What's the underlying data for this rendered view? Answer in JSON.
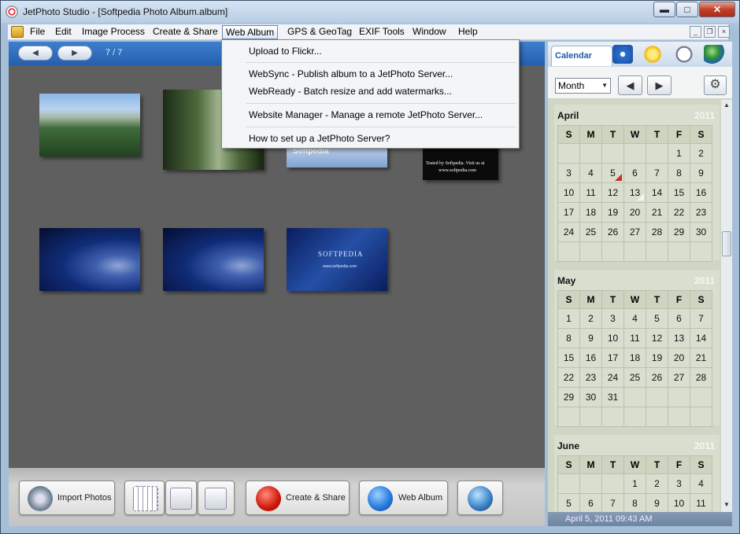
{
  "window": {
    "title": "JetPhoto Studio - [Softpedia Photo Album.album]",
    "controls": {
      "minimize": "▬",
      "maximize": "□",
      "close": "✕"
    }
  },
  "menubar": {
    "items": [
      "File",
      "Edit",
      "Image Process",
      "Create & Share",
      "Web Album",
      "GPS & GeoTag",
      "EXIF Tools",
      "Window",
      "Help"
    ],
    "mdi": {
      "minimize": "_",
      "restore": "❐",
      "close": "×"
    }
  },
  "web_album_menu": {
    "items": [
      "Upload to Flickr...",
      "WebSync - Publish album to a JetPhoto Server...",
      "WebReady - Batch resize and add watermarks...",
      "Website Manager - Manage a remote JetPhoto Server...",
      "How to set up a JetPhoto Server?"
    ]
  },
  "browser": {
    "prev": "◀",
    "next": "▶",
    "counter": "7 / 7",
    "thumbnails": [
      {
        "desc": "mountain forest"
      },
      {
        "desc": "misty forest"
      },
      {
        "desc": "softpedia banner"
      },
      {
        "desc": "tested by softpedia"
      },
      {
        "desc": "blue S logo"
      },
      {
        "desc": "blue S logo 2"
      },
      {
        "desc": "softpedia wallpaper"
      }
    ],
    "thumb_text": {
      "t3": "Softpedia",
      "t4_line1": "Tested by Softpedia. Visit us at",
      "t4_line2": "www.softpedia.com",
      "t7_title": "SOFTPEDIA",
      "t7_url": "www.softpedia.com"
    }
  },
  "bottom_toolbar": {
    "import_label": "Import Photos",
    "create_share_label": "Create & Share",
    "web_album_label": "Web Album"
  },
  "calendar": {
    "tab_label": "Calendar",
    "view_select": "Month",
    "prev": "◀",
    "next": "▶",
    "gear": "⚙",
    "weekdays": [
      "S",
      "M",
      "T",
      "W",
      "T",
      "F",
      "S"
    ],
    "months": [
      {
        "name": "April",
        "year": "2011",
        "weeks": [
          [
            "",
            "",
            "",
            "",
            "",
            "1",
            "2"
          ],
          [
            "3",
            "4",
            "5",
            "6",
            "7",
            "8",
            "9"
          ],
          [
            "10",
            "11",
            "12",
            "13",
            "14",
            "15",
            "16"
          ],
          [
            "17",
            "18",
            "19",
            "20",
            "21",
            "22",
            "23"
          ],
          [
            "24",
            "25",
            "26",
            "27",
            "28",
            "29",
            "30"
          ],
          [
            "",
            "",
            "",
            "",
            "",
            "",
            ""
          ]
        ]
      },
      {
        "name": "May",
        "year": "2011",
        "weeks": [
          [
            "1",
            "2",
            "3",
            "4",
            "5",
            "6",
            "7"
          ],
          [
            "8",
            "9",
            "10",
            "11",
            "12",
            "13",
            "14"
          ],
          [
            "15",
            "16",
            "17",
            "18",
            "19",
            "20",
            "21"
          ],
          [
            "22",
            "23",
            "24",
            "25",
            "26",
            "27",
            "28"
          ],
          [
            "29",
            "30",
            "31",
            "",
            "",
            "",
            ""
          ],
          [
            "",
            "",
            "",
            "",
            "",
            "",
            ""
          ]
        ]
      },
      {
        "name": "June",
        "year": "2011",
        "weeks": [
          [
            "",
            "",
            "",
            "1",
            "2",
            "3",
            "4"
          ],
          [
            "5",
            "6",
            "7",
            "8",
            "9",
            "10",
            "11"
          ]
        ]
      }
    ],
    "status": "April 5, 2011 09:43 AM"
  },
  "colors": {
    "accent": "#245fad",
    "calendar_bg": "#d9dfcf",
    "photo_area": "#5f5f5f"
  }
}
